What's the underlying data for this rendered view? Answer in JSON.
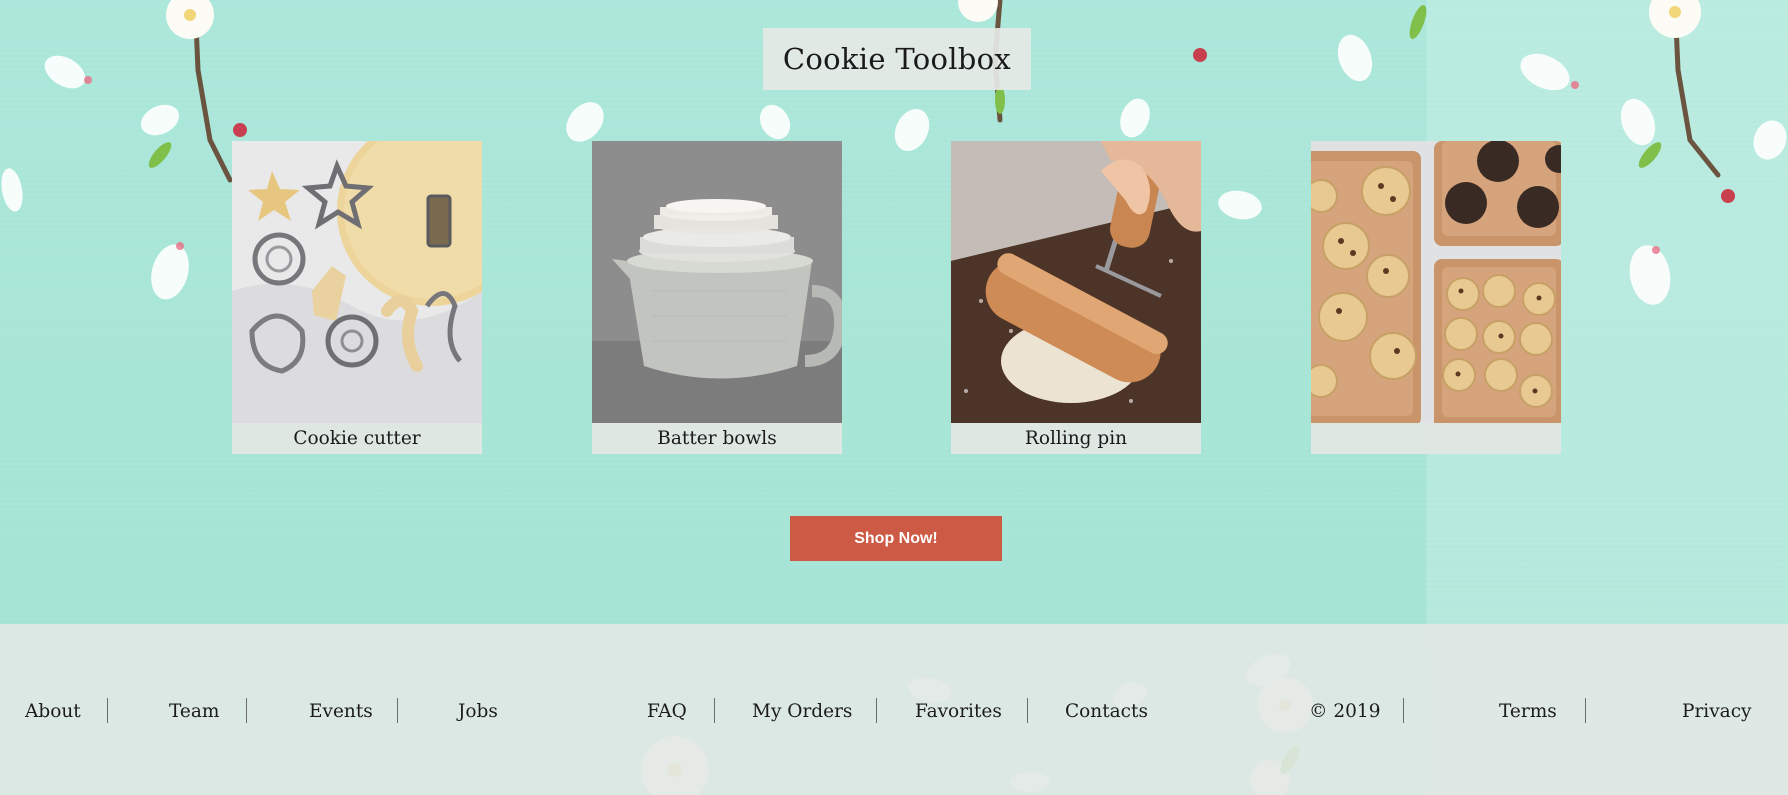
{
  "page": {
    "title": "Cookie Toolbox",
    "colors": {
      "background": "#a6e6d7",
      "panel": "#e2e7e3",
      "button": "#cd5a45",
      "button_text": "#ffffff"
    }
  },
  "cards": [
    {
      "caption": "Cookie cutter",
      "image": "cookie-cutters-photo"
    },
    {
      "caption": "Batter bowls",
      "image": "batter-bowls-photo"
    },
    {
      "caption": "Rolling pin",
      "image": "rolling-pin-photo"
    },
    {
      "caption": "",
      "image": "baking-sheets-photo"
    }
  ],
  "shop_button": {
    "label": "Shop Now!"
  },
  "footer": {
    "links": [
      "About",
      "Team",
      "Events",
      "Jobs",
      "FAQ",
      "My Orders",
      "Favorites",
      "Contacts"
    ],
    "copyright": "© 2019",
    "legal": [
      "Terms",
      "Privacy"
    ]
  }
}
